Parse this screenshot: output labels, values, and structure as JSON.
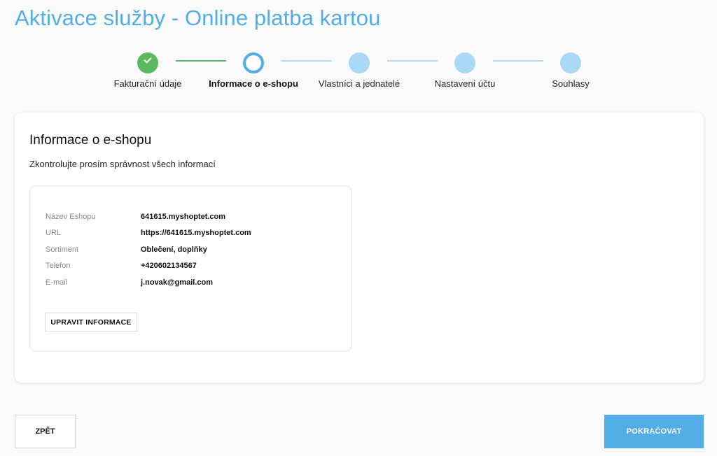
{
  "page": {
    "title": "Aktivace služby - Online platba kartou"
  },
  "stepper": {
    "steps": [
      {
        "label": "Fakturační údaje",
        "state": "done"
      },
      {
        "label": "Informace o e-shopu",
        "state": "current"
      },
      {
        "label": "Vlastníci a jednatelé",
        "state": "future"
      },
      {
        "label": "Nastavení účtu",
        "state": "future"
      },
      {
        "label": "Souhlasy",
        "state": "future"
      }
    ],
    "icons": {
      "done": "check-icon"
    }
  },
  "card": {
    "title": "Informace o e-shopu",
    "subtitle": "Zkontrolujte prosím správnost všech informací",
    "fields": [
      {
        "label": "Název Eshopu",
        "value": "641615.myshoptet.com"
      },
      {
        "label": "URL",
        "value": "https://641615.myshoptet.com"
      },
      {
        "label": "Sortiment",
        "value": "Oblečení, doplňky"
      },
      {
        "label": "Telefon",
        "value": "+420602134567"
      },
      {
        "label": "E-mail",
        "value": "j.novak@gmail.com"
      }
    ],
    "edit_label": "UPRAVIT INFORMACE"
  },
  "footer": {
    "back_label": "ZPĚT",
    "continue_label": "POKRAČOVAT"
  },
  "colors": {
    "accent": "#52ade6",
    "success": "#5cb85c",
    "future_step": "#a9d9f4"
  }
}
